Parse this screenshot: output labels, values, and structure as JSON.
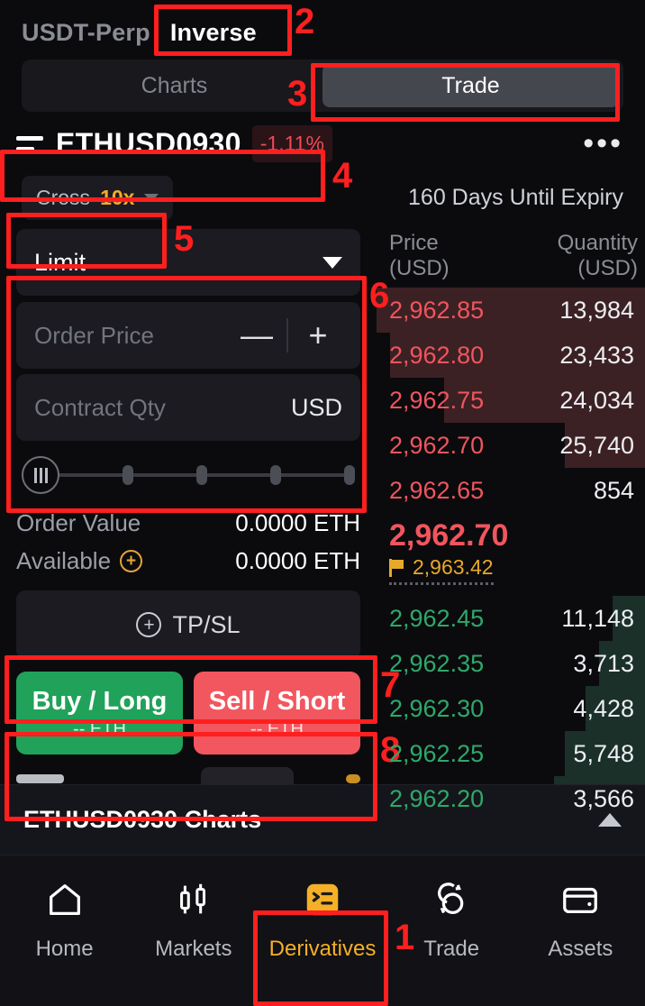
{
  "header": {
    "segments": [
      {
        "label": "USDT-Perp",
        "active": false
      },
      {
        "label": "Inverse",
        "active": true
      }
    ]
  },
  "view_switch": {
    "charts_label": "Charts",
    "trade_label": "Trade",
    "active": "Trade"
  },
  "symbol": {
    "icon": "list-icon",
    "name": "ETHUSD0930",
    "change": "-1.11%",
    "more": "•••"
  },
  "leverage": {
    "margin_mode": "Cross",
    "value": "10x",
    "expiry_note": "160 Days Until Expiry"
  },
  "order_form": {
    "order_type": "Limit",
    "price_placeholder": "Order Price",
    "minus": "—",
    "plus": "+",
    "qty_placeholder": "Contract Qty",
    "qty_unit": "USD",
    "order_value_label": "Order Value",
    "order_value": "0.0000 ETH",
    "available_label": "Available",
    "available_value": "0.0000 ETH",
    "tpsl_label": "TP/SL",
    "buy_label": "Buy / Long",
    "buy_sub": "-- ETH",
    "sell_label": "Sell / Short",
    "sell_sub": "-- ETH"
  },
  "orderbook": {
    "price_header": "Price",
    "price_unit": "(USD)",
    "qty_header": "Quantity",
    "qty_unit": "(USD)",
    "asks": [
      {
        "price": "2,962.85",
        "qty": "13,984",
        "depth": 100
      },
      {
        "price": "2,962.80",
        "qty": "23,433",
        "depth": 95
      },
      {
        "price": "2,962.75",
        "qty": "24,034",
        "depth": 75
      },
      {
        "price": "2,962.70",
        "qty": "25,740",
        "depth": 30
      },
      {
        "price": "2,962.65",
        "qty": "854",
        "depth": 0
      }
    ],
    "last_price": "2,962.70",
    "mark_price": "2,963.42",
    "mark_icon": "flag-icon",
    "bids": [
      {
        "price": "2,962.45",
        "qty": "11,148",
        "depth": 12
      },
      {
        "price": "2,962.35",
        "qty": "3,713",
        "depth": 17
      },
      {
        "price": "2,962.30",
        "qty": "4,428",
        "depth": 22
      },
      {
        "price": "2,962.25",
        "qty": "5,748",
        "depth": 30
      },
      {
        "price": "2,962.20",
        "qty": "3,566",
        "depth": 34
      }
    ]
  },
  "charts_bar": {
    "title": "ETHUSD0930 Charts",
    "caret": "caret-up-icon"
  },
  "tabbar": {
    "items": [
      {
        "label": "Home",
        "icon": "home-icon",
        "active": false
      },
      {
        "label": "Markets",
        "icon": "candlestick-icon",
        "active": false
      },
      {
        "label": "Derivatives",
        "icon": "derivatives-icon",
        "active": true
      },
      {
        "label": "Trade",
        "icon": "swap-circles-icon",
        "active": false
      },
      {
        "label": "Assets",
        "icon": "wallet-icon",
        "active": false
      }
    ]
  },
  "annotations": [
    {
      "num": "1"
    },
    {
      "num": "2"
    },
    {
      "num": "3"
    },
    {
      "num": "4"
    },
    {
      "num": "5"
    },
    {
      "num": "6"
    },
    {
      "num": "7"
    },
    {
      "num": "8"
    }
  ],
  "colors": {
    "accent": "#f5b027",
    "up": "#21a25a",
    "down": "#f2565e",
    "annotation": "#ff1f1f",
    "background": "#0b0b0e"
  }
}
